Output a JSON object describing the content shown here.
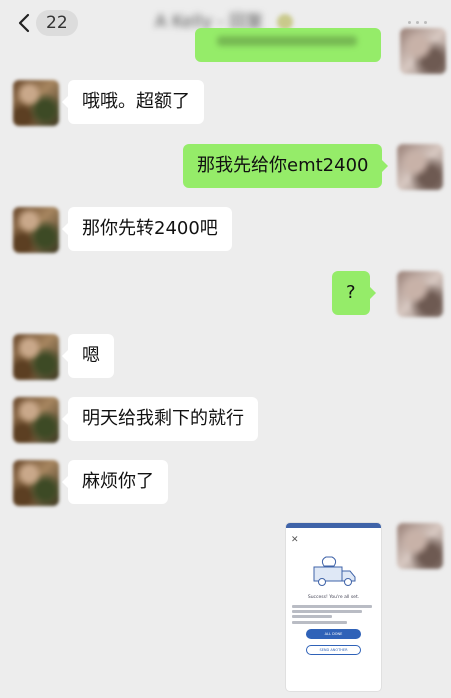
{
  "header": {
    "back_count": "22",
    "contact_name": "A Kelly - 回复"
  },
  "messages": [
    {
      "side": "left",
      "text": "哦哦。超额了"
    },
    {
      "side": "right",
      "text": "那我先给你emt2400"
    },
    {
      "side": "left",
      "text": "那你先转2400吧"
    },
    {
      "side": "right",
      "text": "?"
    },
    {
      "side": "left",
      "text": "嗯"
    },
    {
      "side": "left",
      "text": "明天给我剩下的就行"
    },
    {
      "side": "left",
      "text": "麻烦你了"
    }
  ],
  "image_message": {
    "close_glyph": "✕",
    "title": "Success! You're all set.",
    "button_primary": "ALL DONE",
    "button_secondary": "SEND ANOTHER"
  },
  "colors": {
    "background": "#ededed",
    "bubble_self": "#95ec69",
    "bubble_other": "#ffffff"
  },
  "icons": {
    "back": "chevron-left-icon",
    "more": "more-dots-icon"
  }
}
